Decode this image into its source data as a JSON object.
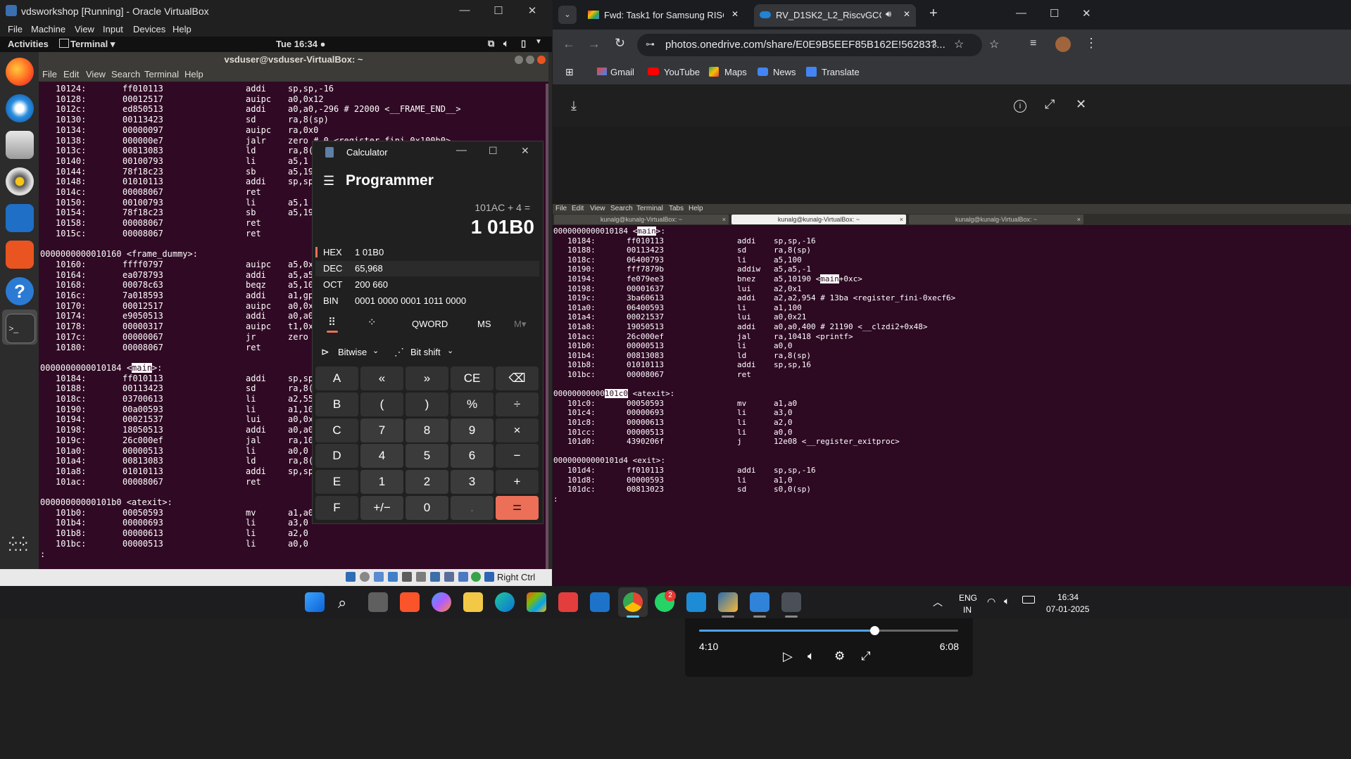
{
  "vbox": {
    "title": "vdsworkshop [Running] - Oracle VirtualBox",
    "menu": [
      "File",
      "Machine",
      "View",
      "Input",
      "Devices",
      "Help"
    ],
    "status_host_key": "Right Ctrl"
  },
  "gnome": {
    "activities": "Activities",
    "app": "Terminal ▾",
    "clock": "Tue 16:34 ●"
  },
  "terminal": {
    "title": "vsduser@vsduser-VirtualBox: ~",
    "menu": [
      "File",
      "Edit",
      "View",
      "Search",
      "Terminal",
      "Help"
    ],
    "lines": [
      [
        "10124:",
        "ff010113",
        "addi",
        "sp,sp,-16"
      ],
      [
        "10128:",
        "00012517",
        "auipc",
        "a0,0x12"
      ],
      [
        "1012c:",
        "ed850513",
        "addi",
        "a0,a0,-296 # 22000 <__FRAME_END__>"
      ],
      [
        "10130:",
        "00113423",
        "sd",
        "ra,8(sp)"
      ],
      [
        "10134:",
        "00000097",
        "auipc",
        "ra,0x0"
      ],
      [
        "10138:",
        "000000e7",
        "jalr",
        "zero # 0 <register_fini-0x100b0>"
      ],
      [
        "1013c:",
        "00813083",
        "ld",
        "ra,8("
      ],
      [
        "10140:",
        "00100793",
        "li",
        "a5,1"
      ],
      [
        "10144:",
        "78f18c23",
        "sb",
        "a5,19"
      ],
      [
        "10148:",
        "01010113",
        "addi",
        "sp,sp"
      ],
      [
        "1014c:",
        "00008067",
        "ret",
        ""
      ],
      [
        "10150:",
        "00100793",
        "li",
        "a5,1"
      ],
      [
        "10154:",
        "78f18c23",
        "sb",
        "a5,19"
      ],
      [
        "10158:",
        "00008067",
        "ret",
        ""
      ],
      [
        "1015c:",
        "00008067",
        "ret",
        ""
      ],
      [
        "",
        "",
        "",
        ""
      ],
      [
        "0000000000010160 <frame_dummy>:",
        "",
        "",
        ""
      ],
      [
        "10160:",
        "ffff0797",
        "auipc",
        "a5,0x"
      ],
      [
        "10164:",
        "ea078793",
        "addi",
        "a5,a5"
      ],
      [
        "10168:",
        "00078c63",
        "beqz",
        "a5,10"
      ],
      [
        "1016c:",
        "7a018593",
        "addi",
        "a1,gp"
      ],
      [
        "10170:",
        "00012517",
        "auipc",
        "a0,0x"
      ],
      [
        "10174:",
        "e9050513",
        "addi",
        "a0,a0"
      ],
      [
        "10178:",
        "00000317",
        "auipc",
        "t1,0x"
      ],
      [
        "1017c:",
        "00000067",
        "jr",
        "zero"
      ],
      [
        "10180:",
        "00008067",
        "ret",
        ""
      ],
      [
        "",
        "",
        "",
        ""
      ],
      [
        "0000000000010184 <main>:",
        "",
        "",
        ""
      ],
      [
        "10184:",
        "ff010113",
        "addi",
        "sp,sp"
      ],
      [
        "10188:",
        "00113423",
        "sd",
        "ra,8("
      ],
      [
        "1018c:",
        "03700613",
        "li",
        "a2,55"
      ],
      [
        "10190:",
        "00a00593",
        "li",
        "a1,10"
      ],
      [
        "10194:",
        "00021537",
        "lui",
        "a0,0x"
      ],
      [
        "10198:",
        "18050513",
        "addi",
        "a0,a0"
      ],
      [
        "1019c:",
        "26c000ef",
        "jal",
        "ra,10"
      ],
      [
        "101a0:",
        "00000513",
        "li",
        "a0,0"
      ],
      [
        "101a4:",
        "00813083",
        "ld",
        "ra,8("
      ],
      [
        "101a8:",
        "01010113",
        "addi",
        "sp,sp"
      ],
      [
        "101ac:",
        "00008067",
        "ret",
        ""
      ],
      [
        "",
        "",
        "",
        ""
      ],
      [
        "00000000000101b0 <atexit>:",
        "",
        "",
        ""
      ],
      [
        "101b0:",
        "00050593",
        "mv",
        "a1,a0"
      ],
      [
        "101b4:",
        "00000693",
        "li",
        "a3,0"
      ],
      [
        "101b8:",
        "00000613",
        "li",
        "a2,0"
      ],
      [
        "101bc:",
        "00000513",
        "li",
        "a0,0"
      ],
      [
        ":",
        "",
        "",
        ""
      ]
    ]
  },
  "calculator": {
    "app_title": "Calculator",
    "mode": "Programmer",
    "expression": "101AC + 4 =",
    "result": "1 01B0",
    "radix": [
      {
        "label": "HEX",
        "value": "1 01B0"
      },
      {
        "label": "DEC",
        "value": "65,968"
      },
      {
        "label": "OCT",
        "value": "200 660"
      },
      {
        "label": "BIN",
        "value": "0001 0000 0001 1011 0000"
      }
    ],
    "word_size": "QWORD",
    "ms": "MS",
    "mplus": "M▾",
    "bitwise": "Bitwise",
    "bitshift": "Bit shift",
    "keys": [
      [
        "A",
        "«",
        "»",
        "CE",
        "⌫"
      ],
      [
        "B",
        "(",
        ")",
        "%",
        "÷"
      ],
      [
        "C",
        "7",
        "8",
        "9",
        "×"
      ],
      [
        "D",
        "4",
        "5",
        "6",
        "−"
      ],
      [
        "E",
        "1",
        "2",
        "3",
        "+"
      ],
      [
        "F",
        "+/−",
        "0",
        ".",
        "="
      ]
    ]
  },
  "browser": {
    "tabs": [
      {
        "title": "Fwd: Task1 for Samsung RISC-V",
        "icon": "gmail-icon"
      },
      {
        "title": "RV_D1SK2_L2_RiscvGCCcom",
        "icon": "onedrive-icon"
      }
    ],
    "url": "photos.onedrive.com/share/E0E9B5EEF85B162E!56283?...",
    "bookmarks": [
      "Gmail",
      "YouTube",
      "Maps",
      "News",
      "Translate"
    ],
    "player": {
      "current": "4:10",
      "total": "6:08",
      "progress": 0.677
    }
  },
  "screenshot_terminal": {
    "menu": [
      "File",
      "Edit",
      "View",
      "Search",
      "Terminal",
      "Tabs",
      "Help"
    ],
    "tabs": [
      "kunalg@kunalg-VirtualBox: ~",
      "kunalg@kunalg-VirtualBox: ~",
      "kunalg@kunalg-VirtualBox: ~"
    ],
    "lines": [
      [
        "0000000000010184 <main>:",
        "",
        "",
        ""
      ],
      [
        "10184:",
        "ff010113",
        "addi",
        "sp,sp,-16"
      ],
      [
        "10188:",
        "00113423",
        "sd",
        "ra,8(sp)"
      ],
      [
        "1018c:",
        "06400793",
        "li",
        "a5,100"
      ],
      [
        "10190:",
        "fff7879b",
        "addiw",
        "a5,a5,-1"
      ],
      [
        "10194:",
        "fe079ee3",
        "bnez",
        "a5,10190 <main+0xc>"
      ],
      [
        "10198:",
        "00001637",
        "lui",
        "a2,0x1"
      ],
      [
        "1019c:",
        "3ba60613",
        "addi",
        "a2,a2,954 # 13ba <register_fini-0xecf6>"
      ],
      [
        "101a0:",
        "06400593",
        "li",
        "a1,100"
      ],
      [
        "101a4:",
        "00021537",
        "lui",
        "a0,0x21"
      ],
      [
        "101a8:",
        "19050513",
        "addi",
        "a0,a0,400 # 21190 <__clzdi2+0x48>"
      ],
      [
        "101ac:",
        "26c000ef",
        "jal",
        "ra,10418 <printf>"
      ],
      [
        "101b0:",
        "00000513",
        "li",
        "a0,0"
      ],
      [
        "101b4:",
        "00813083",
        "ld",
        "ra,8(sp)"
      ],
      [
        "101b8:",
        "01010113",
        "addi",
        "sp,sp,16"
      ],
      [
        "101bc:",
        "00008067",
        "ret",
        ""
      ],
      [
        "",
        "",
        "",
        ""
      ],
      [
        "00000000000101c0 <atexit>:",
        "",
        "",
        ""
      ],
      [
        "101c0:",
        "00050593",
        "mv",
        "a1,a0"
      ],
      [
        "101c4:",
        "00000693",
        "li",
        "a3,0"
      ],
      [
        "101c8:",
        "00000613",
        "li",
        "a2,0"
      ],
      [
        "101cc:",
        "00000513",
        "li",
        "a0,0"
      ],
      [
        "101d0:",
        "4390206f",
        "j",
        "12e08 <__register_exitproc>"
      ],
      [
        "",
        "",
        "",
        ""
      ],
      [
        "00000000000101d4 <exit>:",
        "",
        "",
        ""
      ],
      [
        "101d4:",
        "ff010113",
        "addi",
        "sp,sp,-16"
      ],
      [
        "101d8:",
        "00000593",
        "li",
        "a1,0"
      ],
      [
        "101dc:",
        "00813023",
        "sd",
        "s0,0(sp)"
      ],
      [
        ":",
        "",
        "",
        ""
      ]
    ]
  },
  "taskbar": {
    "lang1": "ENG",
    "lang2": "IN",
    "time": "16:34",
    "date": "07-01-2025",
    "whatsapp_badge": "2"
  }
}
